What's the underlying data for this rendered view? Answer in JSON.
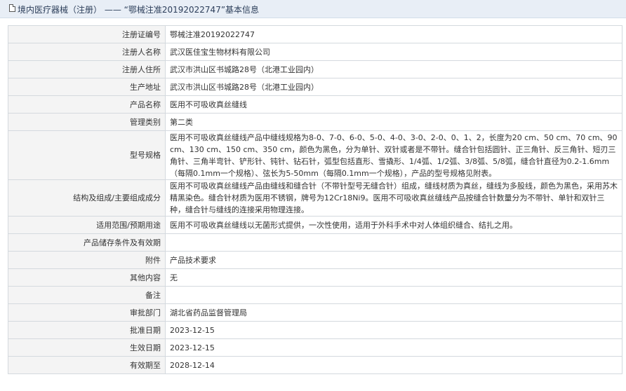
{
  "header": {
    "icon": "document-icon",
    "title": "境内医疗器械（注册） —— “鄂械注准20192022747”基本信息"
  },
  "rows": [
    {
      "label": "注册证编号",
      "value": "鄂械注准20192022747"
    },
    {
      "label": "注册人名称",
      "value": "武汉医佳宝生物材料有限公司"
    },
    {
      "label": "注册人住所",
      "value": "武汉市洪山区书城路28号（北港工业园内）"
    },
    {
      "label": "生产地址",
      "value": "武汉市洪山区书城路28号（北港工业园内）"
    },
    {
      "label": "产品名称",
      "value": "医用不可吸收真丝缝线"
    },
    {
      "label": "管理类别",
      "value": "第二类"
    },
    {
      "label": "型号规格",
      "value": "医用不可吸收真丝缝线产品中缝线规格为8-0、7-0、6-0、5-0、4-0、3-0、2-0、0、1、2，长度为20 cm、50 cm、70 cm、90 cm、130 cm、150 cm、350 cm，颜色为黑色，分为单针、双针或者是不带针。缝合针包括圆针、正三角针、反三角针、短刃三角针、三角半弯针、铲形针、钝针、钻石针，弧型包括直形、雪撬形、1/4弧、1/2弧、3/8弧、5/8弧，缝合针直径为0.2-1.6mm（每隔0.1mm一个规格）、弦长为5-50mm（每隔0.1mm一个规格），产品的型号规格见附表。"
    },
    {
      "label": "结构及组成/主要组成成分",
      "value": "医用不可吸收真丝缝线产品由缝线和缝合针（不带针型号无缝合针）组成，缝线材质为真丝，缝线为多股线，颜色为黑色，采用苏木精黑染色。缝合针材质为医用不锈钢，牌号为12Cr18Ni9。医用不可吸收真丝缝线产品按缝合针数量分为不带针、单针和双针三种，缝合针与缝线的连接采用物理连接。"
    },
    {
      "label": "适用范围/预期用途",
      "value": "医用不可吸收真丝缝线以无菌形式提供，一次性使用，适用于外科手术中对人体组织缝合、结扎之用。"
    },
    {
      "label": "产品储存条件及有效期",
      "value": ""
    },
    {
      "label": "附件",
      "value": "产品技术要求"
    },
    {
      "label": "其他内容",
      "value": "无"
    },
    {
      "label": "备注",
      "value": ""
    },
    {
      "label": "审批部门",
      "value": "湖北省药品监督管理局"
    },
    {
      "label": "批准日期",
      "value": "2023-12-15"
    },
    {
      "label": "生效日期",
      "value": "2023-12-15"
    },
    {
      "label": "有效期至",
      "value": "2028-12-14"
    }
  ]
}
